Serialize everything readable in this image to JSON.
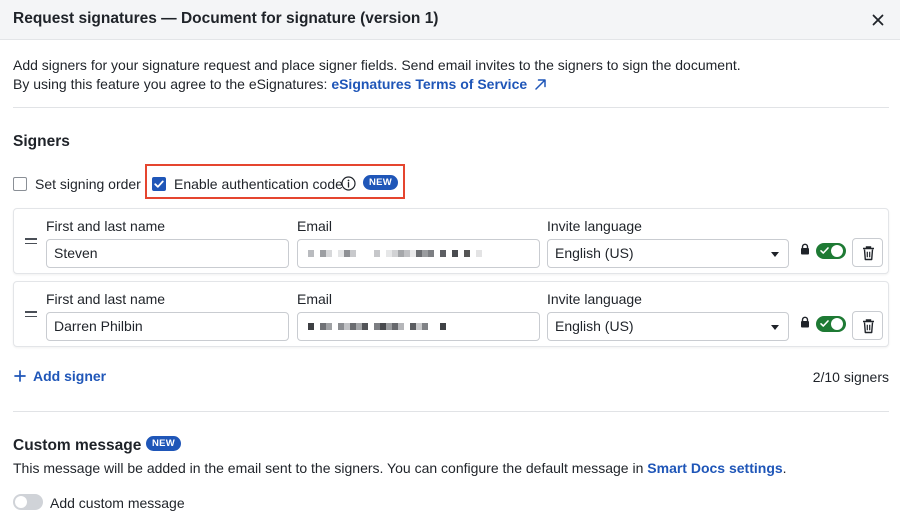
{
  "dialog": {
    "title": "Request signatures — Document for signature (version 1)"
  },
  "intro": {
    "line1": "Add signers for your signature request and place signer fields. Send email invites to the signers to sign the document.",
    "line2_prefix": "By using this feature you agree to the eSignatures: ",
    "terms_link": "eSignatures Terms of Service"
  },
  "signers_section": {
    "title": "Signers",
    "signing_order_label": "Set signing order",
    "signing_order_checked": false,
    "auth_code_label": "Enable authentication code",
    "auth_code_checked": true,
    "new_badge": "NEW",
    "labels": {
      "name": "First and last name",
      "email": "Email",
      "language": "Invite language"
    },
    "signers": [
      {
        "name": "Steven",
        "email": "",
        "language": "English (US)",
        "auth_enabled": true
      },
      {
        "name": "Darren Philbin",
        "email": "",
        "language": "English (US)",
        "auth_enabled": true
      }
    ],
    "add_signer_label": "Add signer",
    "count": "2/10 signers"
  },
  "custom_message": {
    "title": "Custom message",
    "new_badge": "NEW",
    "description_prefix": "This message will be added in the email sent to the signers. You can configure the default message in ",
    "settings_link": "Smart Docs settings",
    "description_suffix": ".",
    "toggle_label": "Add custom message",
    "toggle_on": false
  },
  "colors": {
    "accent": "#1f56b8",
    "highlight_border": "#e5452f",
    "toggle_on": "#1e7a34"
  }
}
